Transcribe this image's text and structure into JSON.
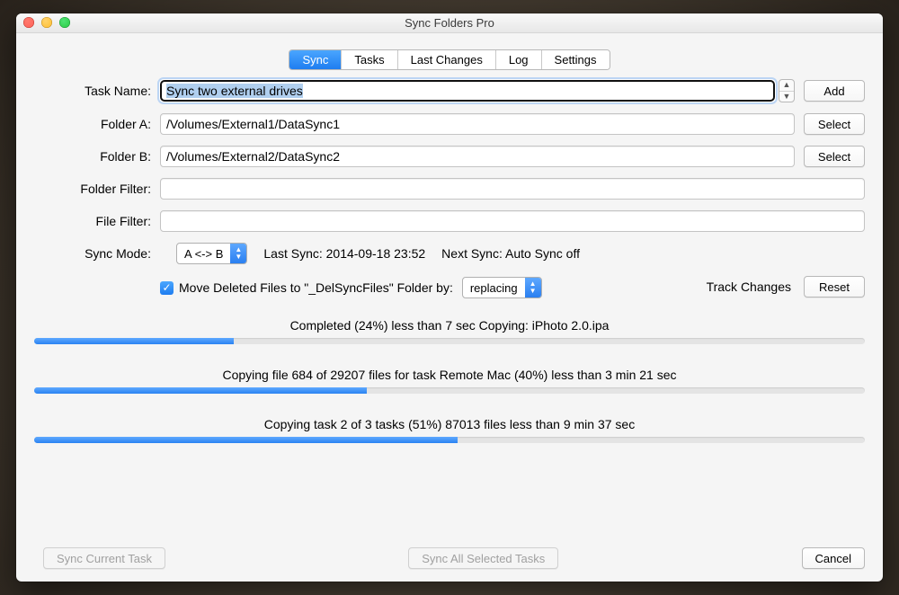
{
  "window": {
    "title": "Sync Folders Pro"
  },
  "tabs": [
    "Sync",
    "Tasks",
    "Last Changes",
    "Log",
    "Settings"
  ],
  "active_tab_index": 0,
  "labels": {
    "task_name": "Task Name:",
    "folder_a": "Folder A:",
    "folder_b": "Folder B:",
    "folder_filter": "Folder Filter:",
    "file_filter": "File Filter:",
    "sync_mode": "Sync Mode:",
    "track_changes": "Track Changes"
  },
  "fields": {
    "task_name": "Sync two external drives",
    "folder_a": "/Volumes/External1/DataSync1",
    "folder_b": "/Volumes/External2/DataSync2",
    "folder_filter": "",
    "file_filter": ""
  },
  "buttons": {
    "add": "Add",
    "select_a": "Select",
    "select_b": "Select",
    "reset": "Reset",
    "sync_current": "Sync Current Task",
    "sync_selected": "Sync All Selected Tasks",
    "cancel": "Cancel"
  },
  "sync_mode": {
    "value": "A <-> B",
    "last_sync": "Last Sync: 2014-09-18 23:52",
    "next_sync": "Next Sync: Auto Sync off"
  },
  "move_deleted": {
    "checked": true,
    "label": "Move Deleted Files to \"_DelSyncFiles\" Folder by:",
    "option": "replacing"
  },
  "progress": [
    {
      "label": "Completed (24%) less than 7 sec Copying: iPhoto 2.0.ipa",
      "percent": 24
    },
    {
      "label": "Copying file 684 of 29207 files for task Remote Mac (40%) less than 3 min 21 sec",
      "percent": 40
    },
    {
      "label": "Copying task 2 of 3 tasks (51%) 87013 files less than 9 min 37 sec",
      "percent": 51
    }
  ]
}
